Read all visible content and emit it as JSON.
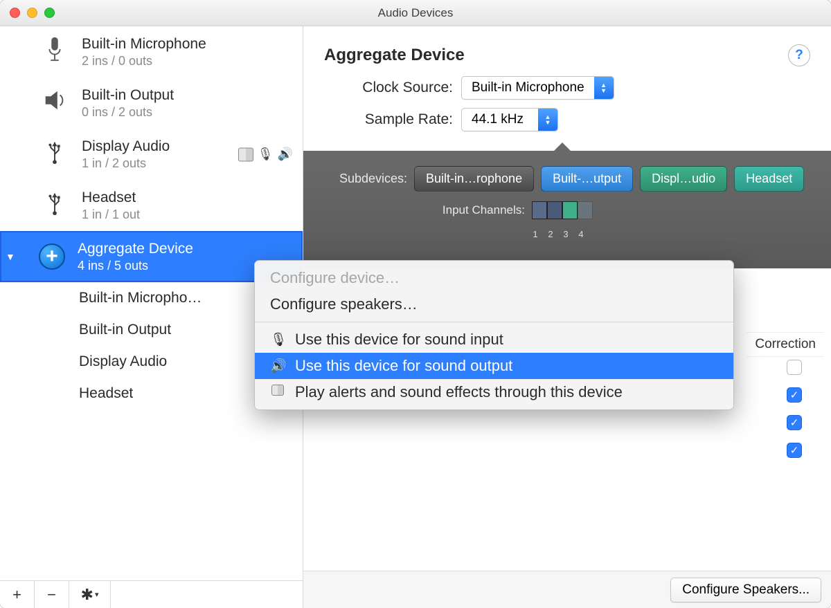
{
  "window": {
    "title": "Audio Devices"
  },
  "devices": [
    {
      "name": "Built-in Microphone",
      "io": "2 ins / 0 outs"
    },
    {
      "name": "Built-in Output",
      "io": "0 ins / 2 outs"
    },
    {
      "name": "Display Audio",
      "io": "1 in / 2 outs"
    },
    {
      "name": "Headset",
      "io": "1 in / 1 out"
    },
    {
      "name": "Aggregate Device",
      "io": "4 ins / 5 outs"
    }
  ],
  "aggregate_children": [
    "Built-in Micropho…",
    "Built-in Output",
    "Display Audio",
    "Headset"
  ],
  "main": {
    "title": "Aggregate Device",
    "clock_label": "Clock Source:",
    "clock_value": "Built-in Microphone",
    "rate_label": "Sample Rate:",
    "rate_value": "44.1 kHz"
  },
  "subdevices": {
    "label": "Subdevices:",
    "pills": [
      "Built-in…rophone",
      "Built-…utput",
      "Displ…udio",
      "Headset"
    ],
    "input_label": "Input Channels:",
    "ch_nums": [
      "1",
      "2",
      "3",
      "4"
    ]
  },
  "table": {
    "correction_header": "Correction",
    "checks": [
      false,
      true,
      true,
      true
    ]
  },
  "footer": {
    "configure_speakers": "Configure Speakers..."
  },
  "menu": {
    "configure_device": "Configure device…",
    "configure_speakers": "Configure speakers…",
    "use_input": "Use this device for sound input",
    "use_output": "Use this device for sound output",
    "play_alerts": "Play alerts and sound effects through this device"
  },
  "sidebar_footer": {
    "plus": "+",
    "minus": "−",
    "gear": "✶"
  }
}
